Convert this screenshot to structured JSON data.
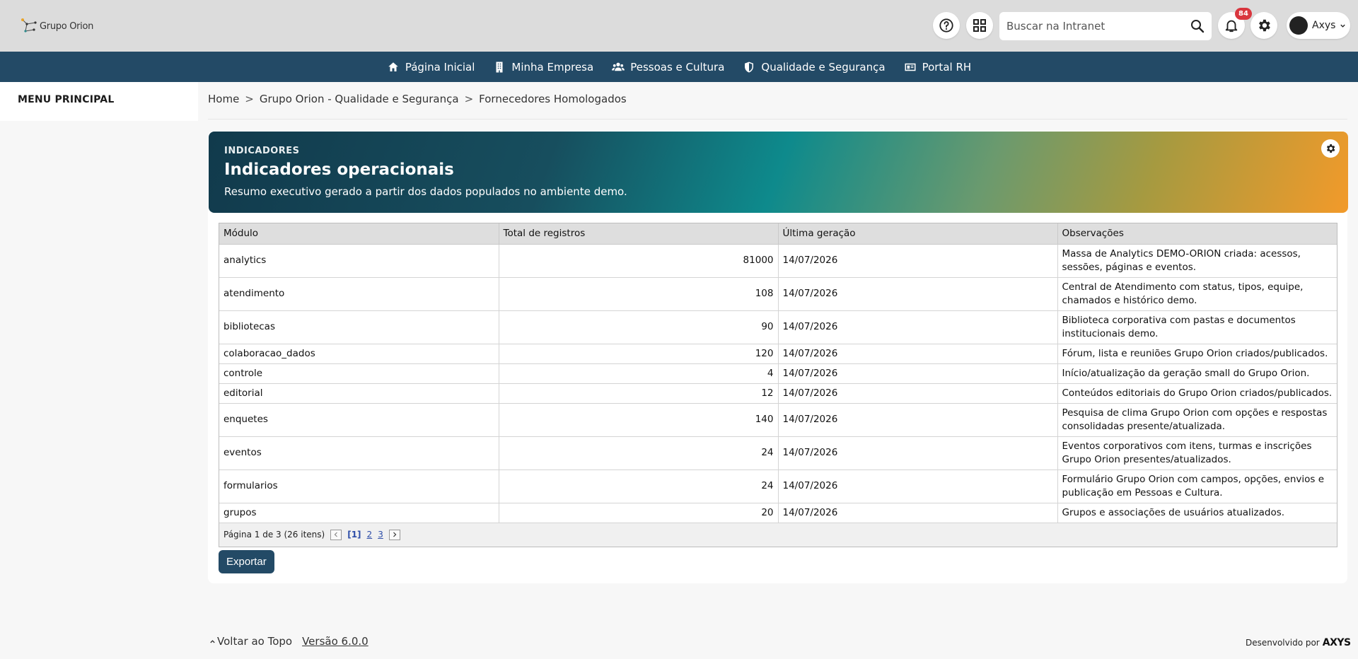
{
  "header": {
    "logo_text": "Grupo Orion",
    "search_placeholder": "Buscar na Intranet",
    "notifications_count": "84",
    "user_name": "Axys"
  },
  "nav": {
    "items": [
      {
        "label": "Página Inicial",
        "icon": "home-icon"
      },
      {
        "label": "Minha Empresa",
        "icon": "building-icon"
      },
      {
        "label": "Pessoas e Cultura",
        "icon": "people-icon"
      },
      {
        "label": "Qualidade e Segurança",
        "icon": "shield-icon"
      },
      {
        "label": "Portal RH",
        "icon": "id-card-icon"
      }
    ]
  },
  "sidebar": {
    "title": "MENU PRINCIPAL"
  },
  "breadcrumb": {
    "items": [
      "Home",
      "Grupo Orion - Qualidade e Segurança",
      "Fornecedores Homologados"
    ],
    "separator": ">"
  },
  "banner": {
    "label": "INDICADORES",
    "title": "Indicadores operacionais",
    "subtitle": "Resumo executivo gerado a partir dos dados populados no ambiente demo."
  },
  "table": {
    "columns": [
      "Módulo",
      "Total de registros",
      "Última geração",
      "Observações"
    ],
    "rows": [
      {
        "modulo": "analytics",
        "total": "81000",
        "data": "14/07/2026",
        "obs": "Massa de Analytics DEMO-ORION criada: acessos, sessões, páginas e eventos."
      },
      {
        "modulo": "atendimento",
        "total": "108",
        "data": "14/07/2026",
        "obs": "Central de Atendimento com status, tipos, equipe, chamados e histórico demo."
      },
      {
        "modulo": "bibliotecas",
        "total": "90",
        "data": "14/07/2026",
        "obs": "Biblioteca corporativa com pastas e documentos institucionais demo."
      },
      {
        "modulo": "colaboracao_dados",
        "total": "120",
        "data": "14/07/2026",
        "obs": "Fórum, lista e reuniões Grupo Orion criados/publicados."
      },
      {
        "modulo": "controle",
        "total": "4",
        "data": "14/07/2026",
        "obs": "Início/atualização da geração small do Grupo Orion."
      },
      {
        "modulo": "editorial",
        "total": "12",
        "data": "14/07/2026",
        "obs": "Conteúdos editoriais do Grupo Orion criados/publicados."
      },
      {
        "modulo": "enquetes",
        "total": "140",
        "data": "14/07/2026",
        "obs": "Pesquisa de clima Grupo Orion com opções e respostas consolidadas presente/atualizada."
      },
      {
        "modulo": "eventos",
        "total": "24",
        "data": "14/07/2026",
        "obs": "Eventos corporativos com itens, turmas e inscrições Grupo Orion presentes/atualizados."
      },
      {
        "modulo": "formularios",
        "total": "24",
        "data": "14/07/2026",
        "obs": "Formulário Grupo Orion com campos, opções, envios e publicação em Pessoas e Cultura."
      },
      {
        "modulo": "grupos",
        "total": "20",
        "data": "14/07/2026",
        "obs": "Grupos e associações de usuários atualizados."
      }
    ]
  },
  "pager": {
    "summary": "Página 1 de 3 (26 itens)",
    "current": "[1]",
    "pages": [
      "2",
      "3"
    ]
  },
  "actions": {
    "export_label": "Exportar"
  },
  "footer": {
    "back_to_top": "Voltar ao Topo",
    "version": "Versão 6.0.0",
    "developed_by": "Desenvolvido por",
    "brand": "AXYS"
  },
  "colors": {
    "topbar": "#dcdcdc",
    "navbar": "#234a66",
    "badge": "#d9363e",
    "link": "#2d4da8"
  }
}
